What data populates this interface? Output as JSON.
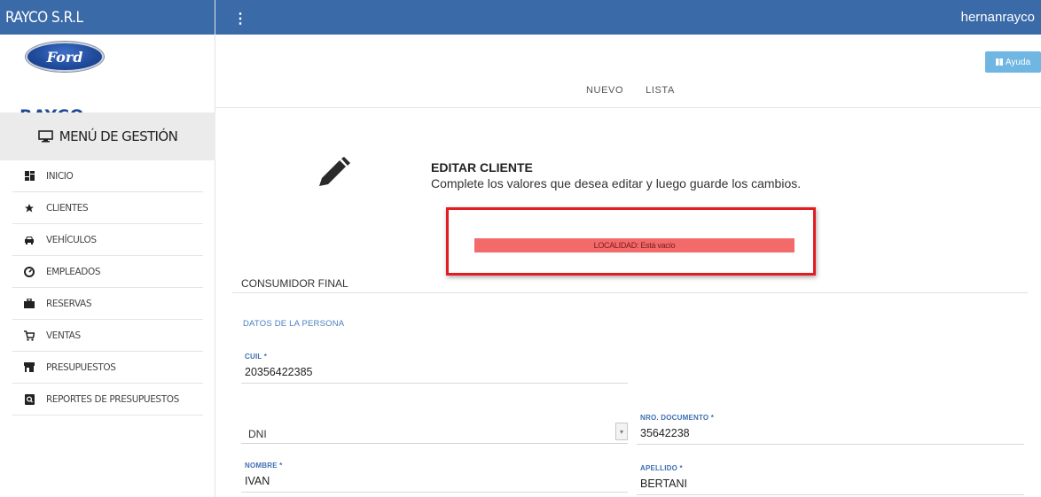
{
  "app": {
    "brand": "RAYCO S.R.L",
    "username": "hernanrayco",
    "logo_oval_text": "Ford",
    "logo_text": "RAYCO"
  },
  "colors": {
    "topbar": "#3a6aa8",
    "help_button": "#6fb7e2",
    "alert_bar": "#f36a6a",
    "alert_frame": "#e21c22",
    "label_blue": "#3f6fb3"
  },
  "sidebar": {
    "menu_header": "MENÚ DE GESTIÓN",
    "menu_header_icon": "monitor-icon",
    "items": [
      {
        "label": "INICIO",
        "icon": "dashboard-icon"
      },
      {
        "label": "CLIENTES",
        "icon": "star-icon"
      },
      {
        "label": "VEHÍCULOS",
        "icon": "car-icon"
      },
      {
        "label": "EMPLEADOS",
        "icon": "gauge-icon"
      },
      {
        "label": "RESERVAS",
        "icon": "briefcase-icon"
      },
      {
        "label": "VENTAS",
        "icon": "cart-icon"
      },
      {
        "label": "PRESUPUESTOS",
        "icon": "store-icon"
      },
      {
        "label": "REPORTES DE PRESUPUESTOS",
        "icon": "report-icon"
      }
    ]
  },
  "topbar": {
    "help_label": "Ayuda",
    "nav": [
      "NUEVO",
      "LISTA"
    ]
  },
  "main": {
    "title": "EDITAR CLIENTE",
    "subtitle": "Complete los valores que desea editar y luego guarde los cambios.",
    "alert": "LOCALIDAD: Está vacío",
    "section": "CONSUMIDOR FINAL",
    "subsection": "DATOS DE LA PERSONA",
    "fields": {
      "cuil": {
        "label": "CUIL *",
        "value": "20356422385"
      },
      "doc_type": {
        "value": "DNI"
      },
      "nro_documento": {
        "label": "NRO. DOCUMENTO *",
        "value": "35642238"
      },
      "nombre": {
        "label": "NOMBRE *",
        "value": "IVAN"
      },
      "apellido": {
        "label": "APELLIDO *",
        "value": "BERTANI"
      }
    }
  }
}
